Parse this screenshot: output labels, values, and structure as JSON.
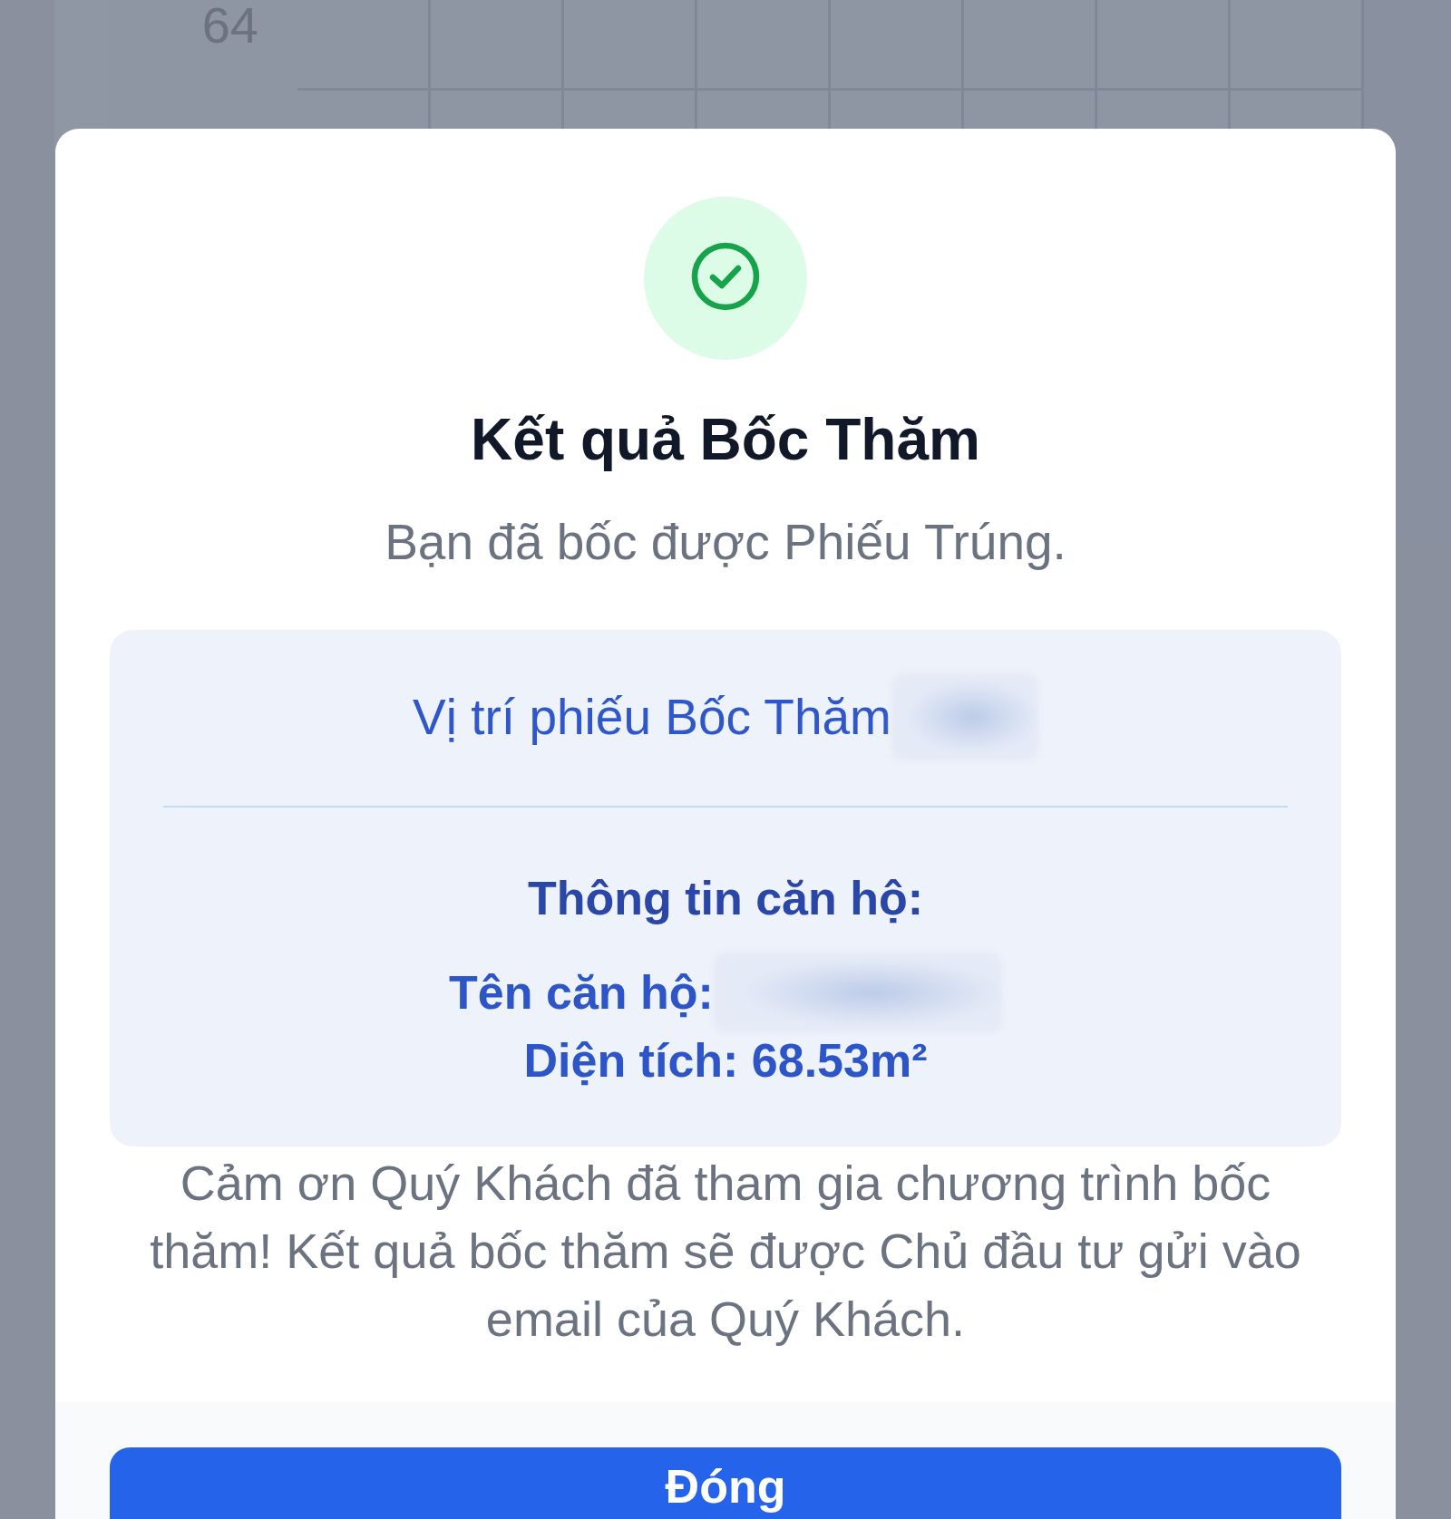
{
  "background_table": {
    "row_number": "64"
  },
  "dialog": {
    "success": true,
    "title": "Kết quả Bốc Thăm",
    "message": "Bạn đã bốc được Phiếu Trúng.",
    "ticket": {
      "label": "Vị trí phiếu Bốc Thăm",
      "value_redacted": true
    },
    "apartment": {
      "heading": "Thông tin căn hộ:",
      "fields": [
        {
          "text": "Tên căn hộ:",
          "redacted": true
        },
        {
          "text": "Diện tích: 68.53m²",
          "redacted": false
        }
      ]
    },
    "note": "Cảm ơn Quý Khách đã tham gia chương trình bốc thăm! Kết quả bốc thăm sẽ được Chủ đầu tư gửi vào email của Quý Khách.",
    "buttons": [
      {
        "label": "Đóng",
        "kind": "primary"
      }
    ]
  }
}
